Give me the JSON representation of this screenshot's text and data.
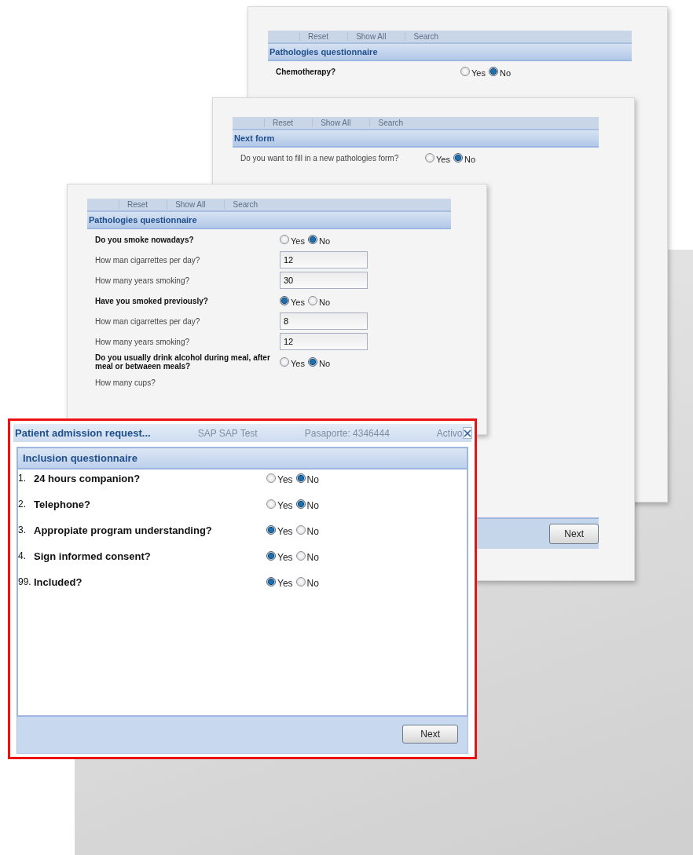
{
  "back_windows": [
    {
      "toolbar": [
        "Reset",
        "Show All",
        "Search"
      ],
      "section_title": "Pathologies questionnaire",
      "questions": [
        {
          "kind": "choice",
          "bold": true,
          "label": "Chemotherapy?",
          "options": [
            {
              "label": "Yes",
              "selected": false
            },
            {
              "label": "No",
              "selected": true
            }
          ]
        }
      ]
    },
    {
      "toolbar": [
        "Reset",
        "Show All",
        "Search"
      ],
      "section_title": "Next form",
      "questions": [
        {
          "kind": "choice",
          "bold": false,
          "label": "Do you want to fill in a new pathologies form?",
          "options": [
            {
              "label": "Yes",
              "selected": false
            },
            {
              "label": "No",
              "selected": true
            }
          ]
        }
      ],
      "footer_button": "Next"
    },
    {
      "toolbar": [
        "Reset",
        "Show All",
        "Search"
      ],
      "section_title": "Pathologies questionnaire",
      "questions": [
        {
          "kind": "choice",
          "bold": true,
          "label": "Do you smoke nowadays?",
          "options": [
            {
              "label": "Yes",
              "selected": false
            },
            {
              "label": "No",
              "selected": true
            }
          ]
        },
        {
          "kind": "number",
          "label": "How man cigarrettes per day?",
          "value": "12"
        },
        {
          "kind": "number",
          "label": "How many years smoking?",
          "value": "30"
        },
        {
          "kind": "choice",
          "bold": true,
          "label": "Have you smoked previously?",
          "options": [
            {
              "label": "Yes",
              "selected": true
            },
            {
              "label": "No",
              "selected": false
            }
          ]
        },
        {
          "kind": "number",
          "label": "How man cigarrettes per day?",
          "value": "8"
        },
        {
          "kind": "number",
          "label": "How many years smoking?",
          "value": "12"
        },
        {
          "kind": "choice",
          "bold": true,
          "label": "Do you usually drink alcohol during meal, after meal or betwaeen meals?",
          "options": [
            {
              "label": "Yes",
              "selected": false
            },
            {
              "label": "No",
              "selected": true
            }
          ]
        },
        {
          "kind": "note",
          "label": "How many cups?"
        }
      ]
    }
  ],
  "dialog": {
    "title": "Patient admission request...",
    "background_texts": [
      "SAP SAP Test",
      "Pasaporte: 4346444",
      "Activo"
    ],
    "section_title": "Inclusion questionnaire",
    "questions": [
      {
        "number": "1.",
        "label": "24 hours companion?",
        "options": [
          {
            "label": "Yes",
            "selected": false
          },
          {
            "label": "No",
            "selected": true
          }
        ]
      },
      {
        "number": "2.",
        "label": "Telephone?",
        "options": [
          {
            "label": "Yes",
            "selected": false
          },
          {
            "label": "No",
            "selected": true
          }
        ]
      },
      {
        "number": "3.",
        "label": "Appropiate program understanding?",
        "options": [
          {
            "label": "Yes",
            "selected": true
          },
          {
            "label": "No",
            "selected": false
          }
        ]
      },
      {
        "number": "4.",
        "label": "Sign informed consent?",
        "options": [
          {
            "label": "Yes",
            "selected": true
          },
          {
            "label": "No",
            "selected": false
          }
        ]
      },
      {
        "number": "99.",
        "label": "Included?",
        "options": [
          {
            "label": "Yes",
            "selected": true
          },
          {
            "label": "No",
            "selected": false
          }
        ]
      }
    ],
    "next_button": "Next"
  }
}
